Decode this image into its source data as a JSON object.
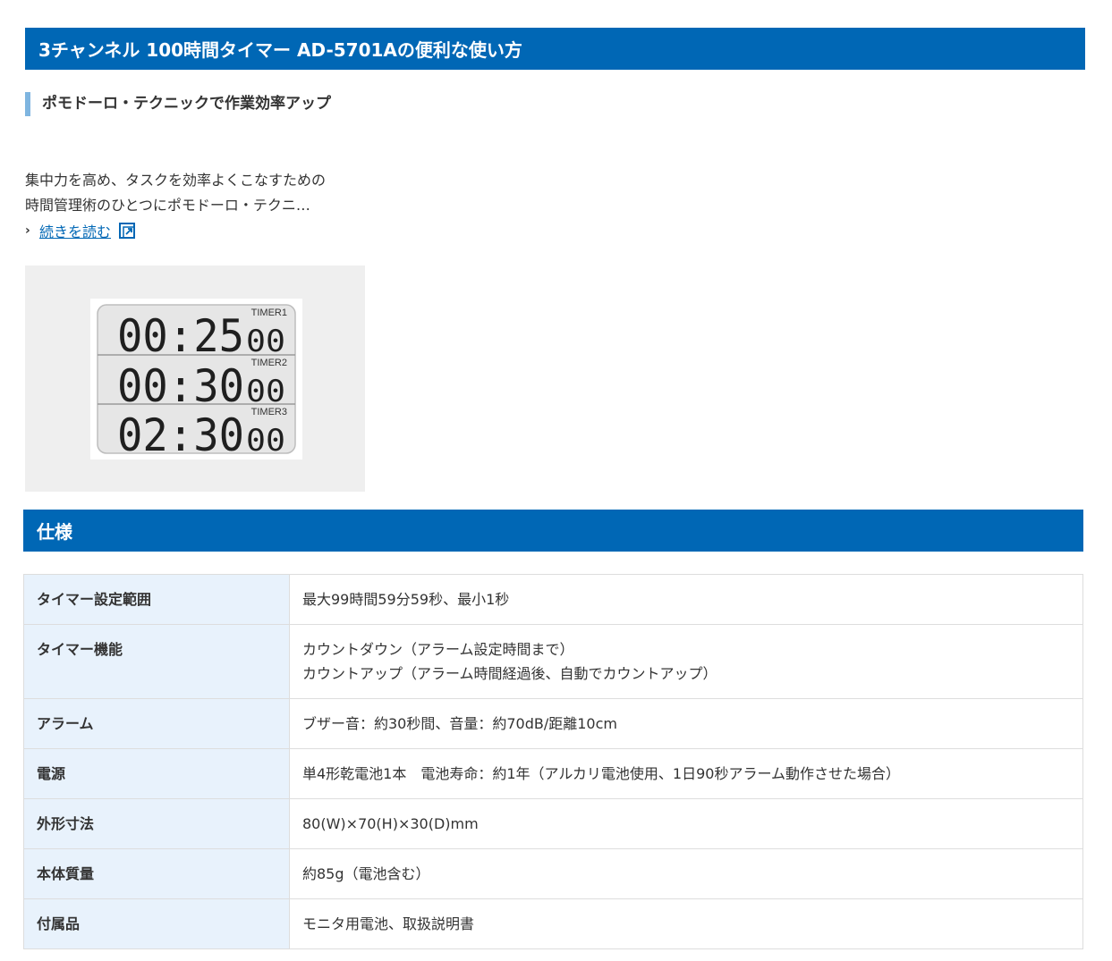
{
  "header1": {
    "title": "3チャンネル 100時間タイマー AD-5701Aの便利な使い方"
  },
  "article": {
    "subheading": "ポモドーロ・テクニックで作業効率アップ",
    "description_line1": "集中力を高め、タスクを効率よくこなすための",
    "description_line2": "時間管理術のひとつにポモドーロ・テクニ…",
    "read_more_label": "続きを読む"
  },
  "timer_display": {
    "timers": [
      {
        "label": "TIMER1",
        "main": "00:25",
        "seconds": "00"
      },
      {
        "label": "TIMER2",
        "main": "00:30",
        "seconds": "00"
      },
      {
        "label": "TIMER3",
        "main": "02:30",
        "seconds": "00"
      }
    ]
  },
  "header2": {
    "title": "仕様"
  },
  "spec": {
    "rows": [
      {
        "label": "タイマー設定範囲",
        "value": "最大99時間59分59秒、最小1秒"
      },
      {
        "label": "タイマー機能",
        "value": "カウントダウン（アラーム設定時間まで）",
        "value2": "カウントアップ（アラーム時間経過後、自動でカウントアップ）"
      },
      {
        "label": "アラーム",
        "value": "ブザー音：約30秒間、音量：約70dB/距離10cm"
      },
      {
        "label": "電源",
        "value": "単4形乾電池1本　電池寿命：約1年（アルカリ電池使用、1日90秒アラーム動作させた場合）"
      },
      {
        "label": "外形寸法",
        "value": "80(W)×70(H)×30(D)mm"
      },
      {
        "label": "本体質量",
        "value": "約85g（電池含む）"
      },
      {
        "label": "付属品",
        "value": "モニタ用電池、取扱説明書"
      }
    ]
  },
  "colors": {
    "header_bg": "#0067b5",
    "accent_bar": "#7fb5e0",
    "label_cell_bg": "#e8f2fc",
    "link": "#0067b5"
  },
  "icons": {
    "chevron": "chevron-right-icon",
    "external": "external-link-icon"
  }
}
